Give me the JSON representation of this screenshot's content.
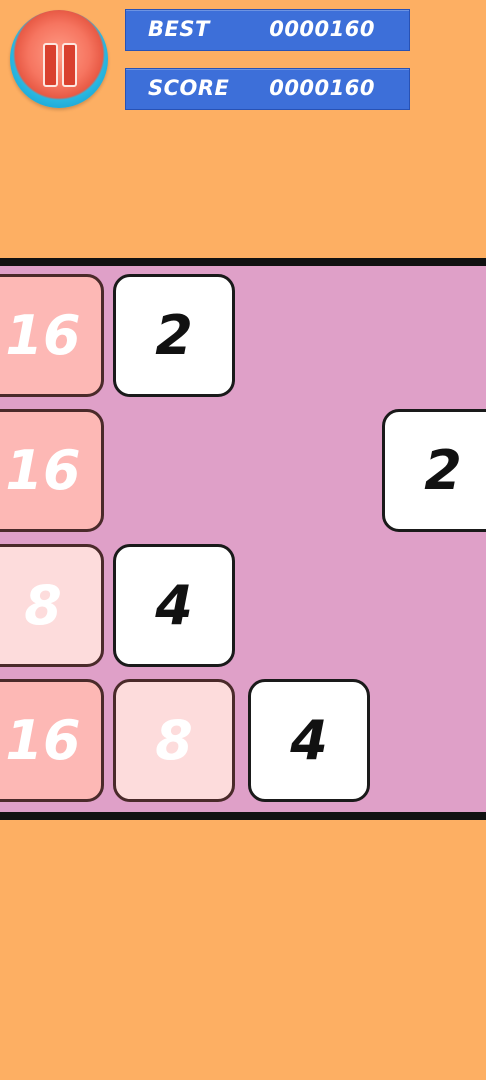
{
  "hud": {
    "pause_icon": "pause-icon",
    "best_label": "BEST",
    "best_value": "0000160",
    "score_label": "SCORE",
    "score_value": "0000160"
  },
  "colors": {
    "background": "#fdaf63",
    "board": "#dfa0c8",
    "panel": "#3d6fd9",
    "tile_2_4": "#ffffff",
    "tile_8": "#fddcdc",
    "tile_16": "#fdb8b5"
  },
  "board": {
    "tiles": [
      {
        "value": "16"
      },
      {
        "value": "2"
      },
      {
        "value": "16"
      },
      {
        "value": "2"
      },
      {
        "value": "8"
      },
      {
        "value": "4"
      },
      {
        "value": "16"
      },
      {
        "value": "8"
      },
      {
        "value": "4"
      }
    ]
  }
}
